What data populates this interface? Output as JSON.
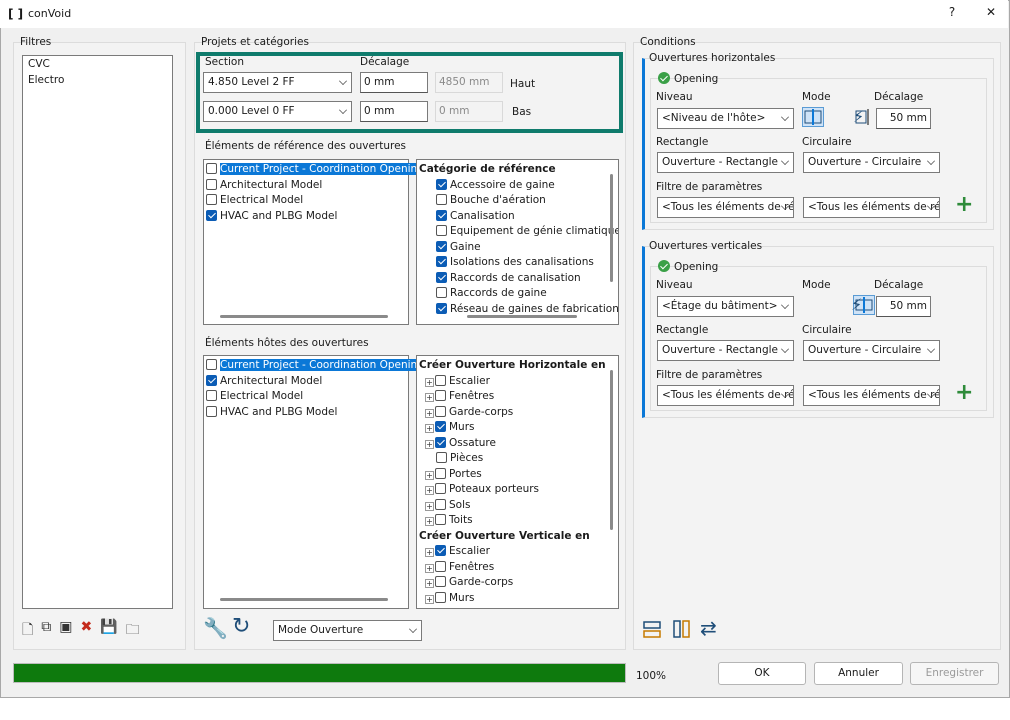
{
  "window": {
    "title": "conVoid",
    "help": "?",
    "close": "✕"
  },
  "filtres": {
    "legend": "Filtres",
    "items": [
      "CVC",
      "Electro"
    ]
  },
  "projets": {
    "legend": "Projets et catégories",
    "section_label": "Section",
    "decalage_label": "Décalage",
    "top": {
      "section": "4.850  Level 2 FF",
      "offset": "0 mm",
      "computed": "4850 mm",
      "side": "Haut"
    },
    "bottom": {
      "section": "0.000  Level 0 FF",
      "offset": "0 mm",
      "computed": "0 mm",
      "side": "Bas"
    }
  },
  "ref": {
    "label": "Éléments de référence des ouvertures",
    "models": [
      {
        "label": "Current Project - Coordination Openings",
        "checked": false,
        "selected": true
      },
      {
        "label": "Architectural Model",
        "checked": false,
        "selected": false
      },
      {
        "label": "Electrical Model",
        "checked": false,
        "selected": false
      },
      {
        "label": "HVAC and PLBG Model",
        "checked": true,
        "selected": false
      }
    ],
    "cat_header": "Catégorie de référence",
    "categories": [
      {
        "label": "Accessoire de gaine",
        "checked": true
      },
      {
        "label": "Bouche d'aération",
        "checked": false
      },
      {
        "label": "Canalisation",
        "checked": true
      },
      {
        "label": "Equipement de génie climatique",
        "checked": false
      },
      {
        "label": "Gaine",
        "checked": true
      },
      {
        "label": "Isolations des canalisations",
        "checked": true
      },
      {
        "label": "Raccords de canalisation",
        "checked": true
      },
      {
        "label": "Raccords de gaine",
        "checked": false
      },
      {
        "label": "Réseau de gaines de fabrication M",
        "checked": true
      }
    ]
  },
  "host": {
    "label": "Éléments hôtes des ouvertures",
    "models": [
      {
        "label": "Current Project - Coordination Openings",
        "checked": false,
        "selected": true
      },
      {
        "label": "Architectural Model",
        "checked": true,
        "selected": false
      },
      {
        "label": "Electrical Model",
        "checked": false,
        "selected": false
      },
      {
        "label": "HVAC and PLBG Model",
        "checked": false,
        "selected": false
      }
    ],
    "horiz_header": "Créer Ouverture Horizontale en",
    "horiz": [
      {
        "label": "Escalier",
        "checked": false,
        "exp": true
      },
      {
        "label": "Fenêtres",
        "checked": false,
        "exp": true
      },
      {
        "label": "Garde-corps",
        "checked": false,
        "exp": true
      },
      {
        "label": "Murs",
        "checked": true,
        "exp": true
      },
      {
        "label": "Ossature",
        "checked": true,
        "exp": true
      },
      {
        "label": "Pièces",
        "checked": false,
        "exp": false
      },
      {
        "label": "Portes",
        "checked": false,
        "exp": true
      },
      {
        "label": "Poteaux porteurs",
        "checked": false,
        "exp": true
      },
      {
        "label": "Sols",
        "checked": false,
        "exp": true
      },
      {
        "label": "Toits",
        "checked": false,
        "exp": true
      }
    ],
    "vert_header": "Créer Ouverture Verticale en",
    "vert": [
      {
        "label": "Escalier",
        "checked": true,
        "exp": true
      },
      {
        "label": "Fenêtres",
        "checked": false,
        "exp": true
      },
      {
        "label": "Garde-corps",
        "checked": false,
        "exp": true
      },
      {
        "label": "Murs",
        "checked": false,
        "exp": true
      }
    ]
  },
  "tools": {
    "mode": "Mode Ouverture"
  },
  "conditions": {
    "legend": "Conditions",
    "horizontal": {
      "legend": "Ouvertures horizontales",
      "opening": "Opening",
      "niveau_label": "Niveau",
      "niveau": "<Niveau de l'hôte>",
      "mode_label": "Mode",
      "decalage_label": "Décalage",
      "decalage": "50 mm",
      "rect_label": "Rectangle",
      "rect": "Ouverture - Rectangle",
      "circ_label": "Circulaire",
      "circ": "Ouverture - Circulaire",
      "filtre_label": "Filtre de paramètres",
      "filtre1": "<Tous les éléments de réf",
      "filtre2": "<Tous les éléments de réf"
    },
    "vertical": {
      "legend": "Ouvertures verticales",
      "opening": "Opening",
      "niveau_label": "Niveau",
      "niveau": "<Étage du bâtiment>",
      "mode_label": "Mode",
      "decalage_label": "Décalage",
      "decalage": "50 mm",
      "rect_label": "Rectangle",
      "rect": "Ouverture - Rectangle",
      "circ_label": "Circulaire",
      "circ": "Ouverture - Circulaire",
      "filtre_label": "Filtre de paramètres",
      "filtre1": "<Tous les éléments de réf",
      "filtre2": "<Tous les éléments de réf"
    }
  },
  "footer": {
    "progress": 1.0,
    "progress_text": "100%",
    "ok": "OK",
    "cancel": "Annuler",
    "save": "Enregistrer"
  },
  "colors": {
    "accent": "#0b78d7",
    "progress": "#0e7a0d",
    "highlight": "#0f7b6c"
  }
}
